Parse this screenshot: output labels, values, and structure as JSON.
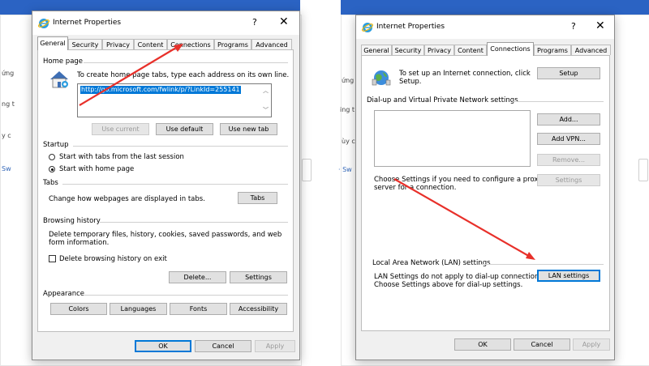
{
  "background": {
    "left_fragments": [
      "ứng",
      "ng t",
      "y c",
      "Sw"
    ],
    "right_fragments": [
      "ứng",
      "ing t",
      "ùy c",
      "· Sw"
    ]
  },
  "dialog_left": {
    "title": "Internet Properties",
    "help": "?",
    "close": "✕",
    "tabs": [
      "General",
      "Security",
      "Privacy",
      "Content",
      "Connections",
      "Programs",
      "Advanced"
    ],
    "active_tab": "General",
    "home_page": {
      "heading": "Home page",
      "description": "To create home page tabs, type each address on its own line.",
      "url": "http://go.microsoft.com/fwlink/p/?LinkId=255141",
      "use_current": "Use current",
      "use_default": "Use default",
      "use_new_tab": "Use new tab"
    },
    "startup": {
      "heading": "Startup",
      "option_last_session": "Start with tabs from the last session",
      "option_home_page": "Start with home page",
      "selected": "Start with home page"
    },
    "tabs_section": {
      "heading": "Tabs",
      "description": "Change how webpages are displayed in tabs.",
      "button": "Tabs"
    },
    "browsing_history": {
      "heading": "Browsing history",
      "description_line1": "Delete temporary files, history, cookies, saved passwords, and web",
      "description_line2": "form information.",
      "checkbox": "Delete browsing history on exit",
      "checkbox_checked": false,
      "delete_button": "Delete...",
      "settings_button": "Settings"
    },
    "appearance": {
      "heading": "Appearance",
      "colors": "Colors",
      "languages": "Languages",
      "fonts": "Fonts",
      "accessibility": "Accessibility"
    },
    "footer": {
      "ok": "OK",
      "cancel": "Cancel",
      "apply": "Apply"
    }
  },
  "dialog_right": {
    "title": "Internet Properties",
    "help": "?",
    "close": "✕",
    "tabs": [
      "General",
      "Security",
      "Privacy",
      "Content",
      "Connections",
      "Programs",
      "Advanced"
    ],
    "active_tab": "Connections",
    "setup": {
      "description_line1": "To set up an Internet connection, click",
      "description_line2": "Setup.",
      "button": "Setup"
    },
    "dialup": {
      "heading": "Dial-up and Virtual Private Network settings",
      "add": "Add...",
      "add_vpn": "Add VPN...",
      "remove": "Remove...",
      "settings": "Settings",
      "hint_line1": "Choose Settings if you need to configure a proxy",
      "hint_line2": "server for a connection."
    },
    "lan": {
      "heading": "Local Area Network (LAN) settings",
      "description_line1": "LAN Settings do not apply to dial-up connections.",
      "description_line2": "Choose Settings above for dial-up settings.",
      "button": "LAN settings"
    },
    "footer": {
      "ok": "OK",
      "cancel": "Cancel",
      "apply": "Apply"
    }
  },
  "colors": {
    "arrow": "#e8302a",
    "accent": "#0078d7",
    "title_blue": "#2b63c3"
  }
}
